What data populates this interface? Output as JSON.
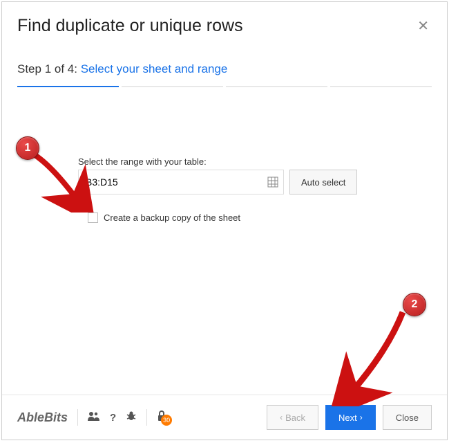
{
  "header": {
    "title": "Find duplicate or unique rows"
  },
  "step": {
    "prefix": "Step 1 of 4: ",
    "link": "Select your sheet and range"
  },
  "form": {
    "range_label": "Select the range with your table:",
    "range_value": "B3:D15",
    "auto_select_label": "Auto select",
    "backup_label": "Create a backup copy of the sheet"
  },
  "footer": {
    "logo": "AbleBits",
    "badge": "30",
    "back_label": "Back",
    "next_label": "Next",
    "close_label": "Close"
  },
  "annotations": {
    "one": "1",
    "two": "2"
  }
}
